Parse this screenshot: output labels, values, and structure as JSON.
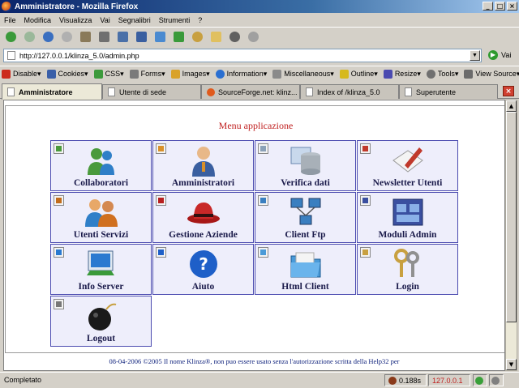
{
  "window": {
    "title": "Amministratore - Mozilla Firefox"
  },
  "menubar": [
    "File",
    "Modifica",
    "Visualizza",
    "Vai",
    "Segnalibri",
    "Strumenti",
    "?"
  ],
  "navbar": {
    "icons": [
      "back-icon",
      "forward-icon",
      "reload-icon",
      "stop-icon",
      "home-icon",
      "print-icon",
      "window-icon",
      "tab-icon",
      "bookmark-icon",
      "download-icon",
      "history-icon",
      "mail-icon",
      "globe-icon",
      "settings-icon"
    ]
  },
  "urlbar": {
    "url": "http://127.0.0.1/klinza_5.0/admin.php",
    "go_label": "Vai"
  },
  "devbar": {
    "items": [
      {
        "label": "Disable▾",
        "color": "#cc2a1c"
      },
      {
        "label": "Cookies▾",
        "color": "#3a5fa8"
      },
      {
        "label": "CSS▾",
        "color": "#3c9a3c"
      },
      {
        "label": "Forms▾",
        "color": "#7a7a7a"
      },
      {
        "label": "Images▾",
        "color": "#d9a229"
      },
      {
        "label": "Information▾",
        "color": "#2a6fd1"
      },
      {
        "label": "Miscellaneous▾",
        "color": "#8a8a8a"
      },
      {
        "label": "Outline▾",
        "color": "#d6b91e"
      },
      {
        "label": "Resize▾",
        "color": "#4a4ab0"
      },
      {
        "label": "Tools▾",
        "color": "#707070"
      },
      {
        "label": "View Source▾",
        "color": "#6b6b6b"
      }
    ]
  },
  "tabs": [
    {
      "label": "Amministratore",
      "active": true
    },
    {
      "label": "Utente di sede"
    },
    {
      "label": "SourceForge.net: klinz..."
    },
    {
      "label": "Index of /klinza_5.0"
    },
    {
      "label": "Superutente"
    }
  ],
  "page": {
    "menu_title": "Menu applicazione",
    "items": [
      {
        "label": "Collaboratori",
        "icon": "users-icon",
        "color": "#4a9a3c"
      },
      {
        "label": "Amministratori",
        "icon": "admin-user-icon",
        "color": "#d9902a"
      },
      {
        "label": "Verifica dati",
        "icon": "database-icon",
        "color": "#8aa0b8"
      },
      {
        "label": "Newsletter Utenti",
        "icon": "newsletter-icon",
        "color": "#c0392b"
      },
      {
        "label": "Utenti Servizi",
        "icon": "user-services-icon",
        "color": "#c26c1a"
      },
      {
        "label": "Gestione Aziende",
        "icon": "hat-icon",
        "color": "#b82020"
      },
      {
        "label": "Client Ftp",
        "icon": "network-icon",
        "color": "#3a7fc0"
      },
      {
        "label": "Moduli Admin",
        "icon": "window-modules-icon",
        "color": "#3a4fa0"
      },
      {
        "label": "Info Server",
        "icon": "server-info-icon",
        "color": "#2a7ad0"
      },
      {
        "label": "Aiuto",
        "icon": "help-icon",
        "color": "#1e5fc8"
      },
      {
        "label": "Html Client",
        "icon": "folder-icon",
        "color": "#4a9ad8"
      },
      {
        "label": "Login",
        "icon": "keys-icon",
        "color": "#c8a040"
      },
      {
        "label": "Logout",
        "icon": "bomb-icon",
        "color": "#1a1a1a"
      }
    ],
    "footer": "08-04-2006 ©2005 Il nome Klinza®, non puo essere usato senza l'autorizzazione scritta della Help32 per"
  },
  "status": {
    "text": "Completato",
    "time": "0.188s",
    "ip": "127.0.0.1"
  }
}
